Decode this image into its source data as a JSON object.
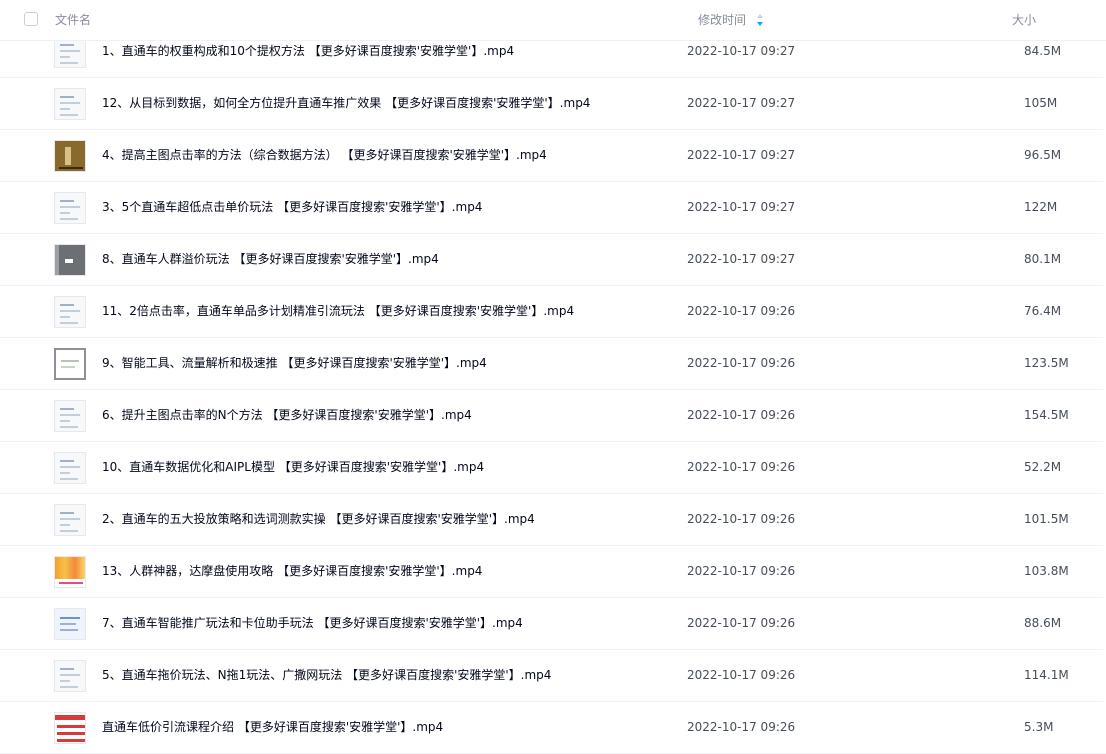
{
  "header": {
    "name_label": "文件名",
    "time_label": "修改时间",
    "size_label": "大小",
    "sort_icon": "sort-desc-icon",
    "sort_color": "#06a7ff"
  },
  "files": [
    {
      "name": "1、直通车的权重构成和10个提权方法 【更多好课百度搜索'安雅学堂'】.mp4",
      "time": "2022-10-17 09:27",
      "size": "84.5M",
      "thumb": "doc"
    },
    {
      "name": "12、从目标到数据，如何全方位提升直通车推广效果 【更多好课百度搜索'安雅学堂'】.mp4",
      "time": "2022-10-17 09:27",
      "size": "105M",
      "thumb": "doc"
    },
    {
      "name": "4、提高主图点击率的方法（综合数据方法） 【更多好课百度搜索'安雅学堂'】.mp4",
      "time": "2022-10-17 09:27",
      "size": "96.5M",
      "thumb": "brown"
    },
    {
      "name": "3、5个直通车超低点击单价玩法 【更多好课百度搜索'安雅学堂'】.mp4",
      "time": "2022-10-17 09:27",
      "size": "122M",
      "thumb": "doc"
    },
    {
      "name": "8、直通车人群溢价玩法 【更多好课百度搜索'安雅学堂'】.mp4",
      "time": "2022-10-17 09:27",
      "size": "80.1M",
      "thumb": "dark"
    },
    {
      "name": "11、2倍点击率，直通车单品多计划精准引流玩法 【更多好课百度搜索'安雅学堂'】.mp4",
      "time": "2022-10-17 09:26",
      "size": "76.4M",
      "thumb": "doc"
    },
    {
      "name": "9、智能工具、流量解析和极速推 【更多好课百度搜索'安雅学堂'】.mp4",
      "time": "2022-10-17 09:26",
      "size": "123.5M",
      "thumb": "frame"
    },
    {
      "name": "6、提升主图点击率的N个方法 【更多好课百度搜索'安雅学堂'】.mp4",
      "time": "2022-10-17 09:26",
      "size": "154.5M",
      "thumb": "doc"
    },
    {
      "name": "10、直通车数据优化和AIPL模型 【更多好课百度搜索'安雅学堂'】.mp4",
      "time": "2022-10-17 09:26",
      "size": "52.2M",
      "thumb": "doc"
    },
    {
      "name": "2、直通车的五大投放策略和选词测款实操 【更多好课百度搜索'安雅学堂'】.mp4",
      "time": "2022-10-17 09:26",
      "size": "101.5M",
      "thumb": "doc"
    },
    {
      "name": "13、人群神器，达摩盘使用攻略 【更多好课百度搜索'安雅学堂'】.mp4",
      "time": "2022-10-17 09:26",
      "size": "103.8M",
      "thumb": "color"
    },
    {
      "name": "7、直通车智能推广玩法和卡位助手玩法 【更多好课百度搜索'安雅学堂'】.mp4",
      "time": "2022-10-17 09:26",
      "size": "88.6M",
      "thumb": "blue"
    },
    {
      "name": "5、直通车拖价玩法、N拖1玩法、广撒网玩法 【更多好课百度搜索'安雅学堂'】.mp4",
      "time": "2022-10-17 09:26",
      "size": "114.1M",
      "thumb": "doc"
    },
    {
      "name": "直通车低价引流课程介绍 【更多好课百度搜索'安雅学堂'】.mp4",
      "time": "2022-10-17 09:26",
      "size": "5.3M",
      "thumb": "red"
    }
  ]
}
